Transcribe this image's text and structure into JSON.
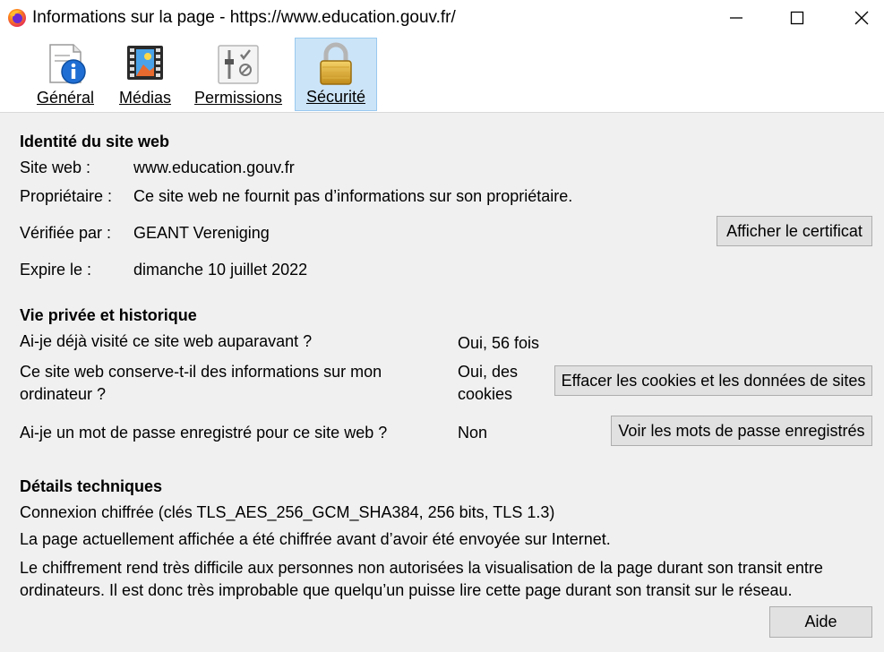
{
  "window": {
    "title": "Informations sur la page - https://www.education.gouv.fr/",
    "controls": [
      "minimize",
      "maximize",
      "close"
    ]
  },
  "tabs": [
    {
      "label": "Général",
      "icon": "info-icon",
      "selected": false
    },
    {
      "label": "Médias",
      "icon": "media-icon",
      "selected": false
    },
    {
      "label": "Permissions",
      "icon": "permissions-icon",
      "selected": false
    },
    {
      "label": "Sécurité",
      "icon": "lock-icon",
      "selected": true
    }
  ],
  "identity": {
    "heading": "Identité du site web",
    "website_label": "Site web :",
    "website_value": "www.education.gouv.fr",
    "owner_label": "Propriétaire :",
    "owner_value": "Ce site web ne fournit pas d’informations sur son propriétaire.",
    "verified_label": "Vérifiée par :",
    "verified_value": "GEANT Vereniging",
    "expires_label": "Expire le :",
    "expires_value": "dimanche 10 juillet 2022",
    "view_cert_button": "Afficher le certificat"
  },
  "privacy": {
    "heading": "Vie privée et historique",
    "q1": "Ai-je déjà visité ce site web auparavant ?",
    "a1": "Oui, 56 fois",
    "q2_line1": "Ce site web conserve-t-il des informations sur mon",
    "q2_line2": "ordinateur ?",
    "a2_line1": "Oui, des",
    "a2_line2": "cookies",
    "clear_cookies_button": "Effacer les cookies et les données de sites",
    "q3": "Ai-je un mot de passe enregistré pour ce site web ?",
    "a3": "Non",
    "view_passwords_button": "Voir les mots de passe enregistrés"
  },
  "technical": {
    "heading": "Détails techniques",
    "line1": "Connexion chiffrée (clés TLS_AES_256_GCM_SHA384, 256 bits, TLS 1.3)",
    "line2": "La page actuellement affichée a été chiffrée avant d’avoir été envoyée sur Internet.",
    "line3": "Le chiffrement rend très difficile aux personnes non autorisées la visualisation de la page durant son transit entre",
    "line4": "ordinateurs. Il est donc très improbable que quelqu’un puisse lire cette page durant son transit sur le réseau."
  },
  "help_button": "Aide"
}
